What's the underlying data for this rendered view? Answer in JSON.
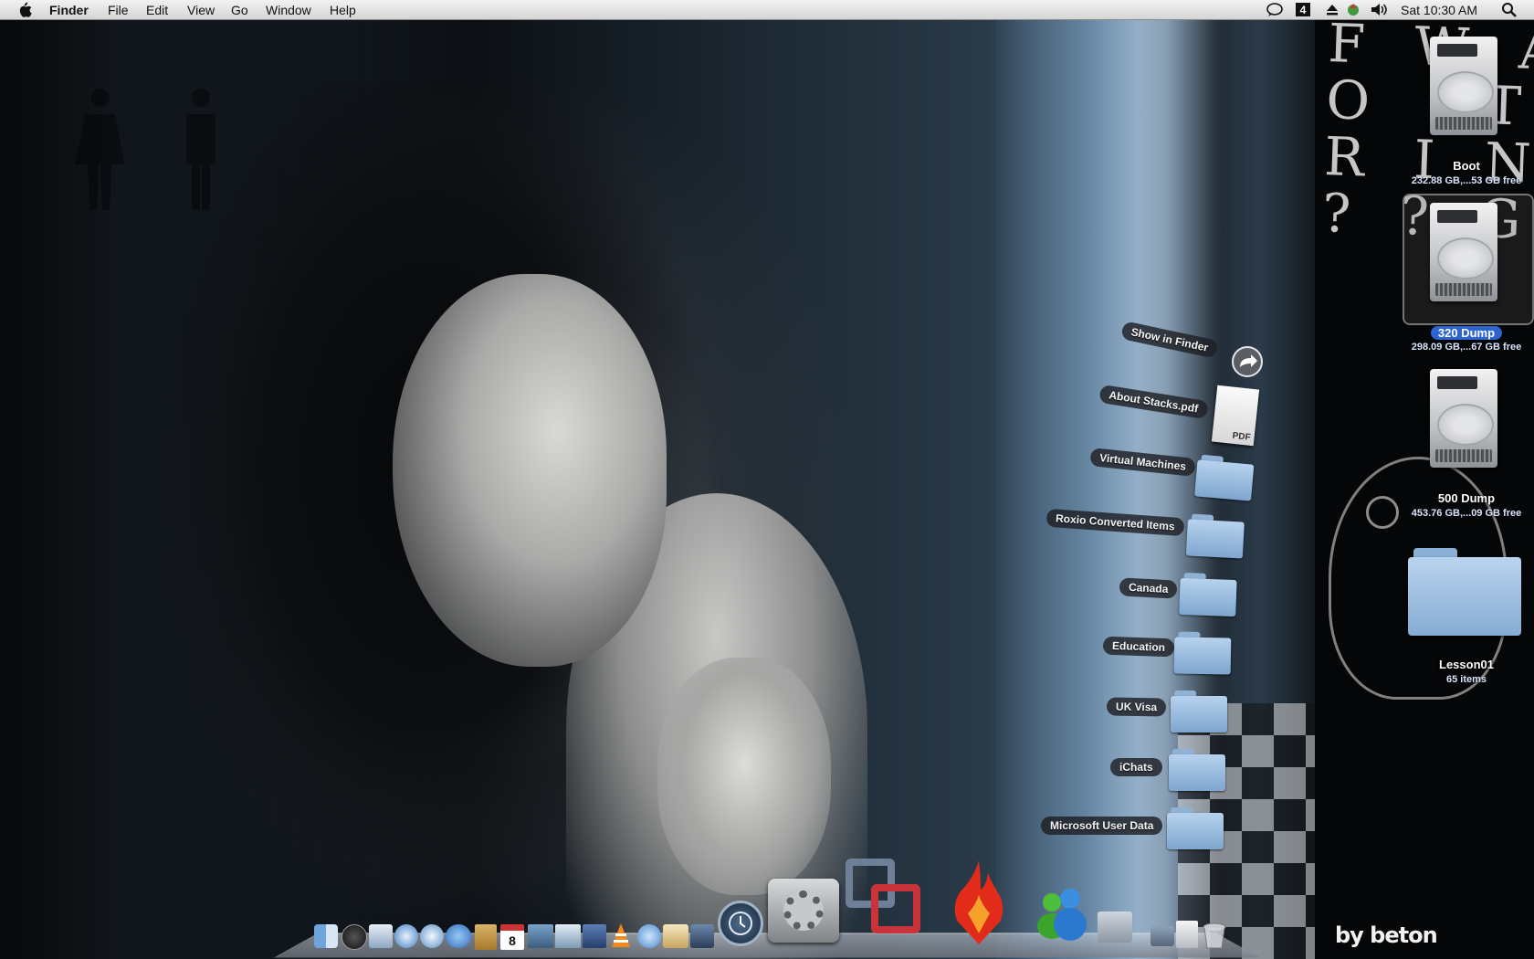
{
  "menubar": {
    "app_name": "Finder",
    "menus": [
      "File",
      "Edit",
      "View",
      "Go",
      "Window",
      "Help"
    ],
    "clock": "Sat 10:30 AM",
    "status_icons": [
      "chat-bubble-icon",
      "spaces-icon",
      "eject-icon",
      "airport-icon",
      "volume-icon",
      "spotlight-icon"
    ]
  },
  "wallpaper": {
    "grunge_text": "F W A I\nO   T\nR I N\n? ? G",
    "signature": "by beton"
  },
  "stack": {
    "items": [
      {
        "label": "Show in Finder",
        "icon": "arrow-circle-icon"
      },
      {
        "label": "About Stacks.pdf",
        "icon": "pdf-document-icon",
        "badge": "PDF"
      },
      {
        "label": "Virtual Machines",
        "icon": "folder-icon"
      },
      {
        "label": "Roxio Converted Items",
        "icon": "folder-icon"
      },
      {
        "label": "Canada",
        "icon": "folder-icon"
      },
      {
        "label": "Education",
        "icon": "folder-icon"
      },
      {
        "label": "UK Visa",
        "icon": "folder-icon"
      },
      {
        "label": "iChats",
        "icon": "folder-icon"
      },
      {
        "label": "Microsoft User Data",
        "icon": "folder-icon"
      }
    ]
  },
  "desktop": {
    "icons": [
      {
        "title": "Boot",
        "subtitle": "232.88 GB,...53 GB free",
        "icon": "hard-drive-icon",
        "selected": false
      },
      {
        "title": "320 Dump",
        "subtitle": "298.09 GB,...67 GB free",
        "icon": "hard-drive-icon",
        "selected": true
      },
      {
        "title": "500 Dump",
        "subtitle": "453.76 GB,...09 GB free",
        "icon": "hard-drive-icon",
        "selected": false
      },
      {
        "title": "Lesson01",
        "subtitle": "65 items",
        "icon": "folder-icon",
        "selected": false
      }
    ]
  },
  "dock": {
    "small_icons": [
      "finder-icon",
      "dashboard-icon",
      "preview-icon",
      "safari-icon",
      "safari-alt-icon",
      "ichat-icon",
      "address-book-icon",
      "ical-icon",
      "iphoto-icon",
      "openoffice-icon",
      "numbers-icon",
      "vlc-icon",
      "itunes-icon",
      "mail-icon",
      "spaces-icon"
    ],
    "large_icons": [
      "time-machine-icon",
      "system-preferences-icon",
      "vmware-fusion-icon",
      "flame-app-icon",
      "messenger-icon",
      "finder-folder-icon",
      "downloads-stack-icon",
      "documents-stack-icon",
      "trash-icon"
    ],
    "ical_date": "8"
  },
  "colors": {
    "menubar_top": "#f2f2f2",
    "menubar_bottom": "#d5d5d5",
    "selection_blue": "#2e64d0",
    "folder_blue": "#9cc0e4"
  }
}
